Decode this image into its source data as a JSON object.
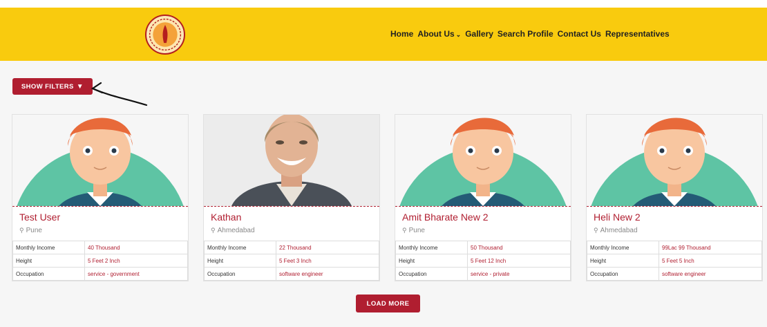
{
  "header": {
    "nav": [
      {
        "label": "Home"
      },
      {
        "label": "About Us",
        "dropdown": true
      },
      {
        "label": "Gallery"
      },
      {
        "label": "Search Profile"
      },
      {
        "label": "Contact Us"
      },
      {
        "label": "Representatives"
      }
    ]
  },
  "filters": {
    "label": "SHOW FILTERS"
  },
  "load_more": {
    "label": "LOAD MORE"
  },
  "field_labels": {
    "income": "Monthly Income",
    "height": "Height",
    "occupation": "Occupation"
  },
  "profiles": [
    {
      "name": "Test User",
      "city": "Pune",
      "income": "40 Thousand",
      "height": "5 Feet 2 Inch",
      "occupation": "service - government",
      "photo": "avatar-illustration"
    },
    {
      "name": "Kathan",
      "city": "Ahmedabad",
      "income": "22 Thousand",
      "height": "5 Feet 3 Inch",
      "occupation": "software engineer",
      "photo": "smiling-man-photo"
    },
    {
      "name": "Amit Bharate New 2",
      "city": "Pune",
      "income": "50 Thousand",
      "height": "5 Feet 12 Inch",
      "occupation": "service - private",
      "photo": "avatar-illustration"
    },
    {
      "name": "Heli New 2",
      "city": "Ahmedabad",
      "income": "99Lac 99 Thousand",
      "height": "5 Feet 5 Inch",
      "occupation": "software engineer",
      "photo": "avatar-illustration"
    }
  ],
  "colors": {
    "header_bg": "#f9cb0e",
    "accent": "#b01e30",
    "avatar_bg": "#5ec4a4"
  }
}
